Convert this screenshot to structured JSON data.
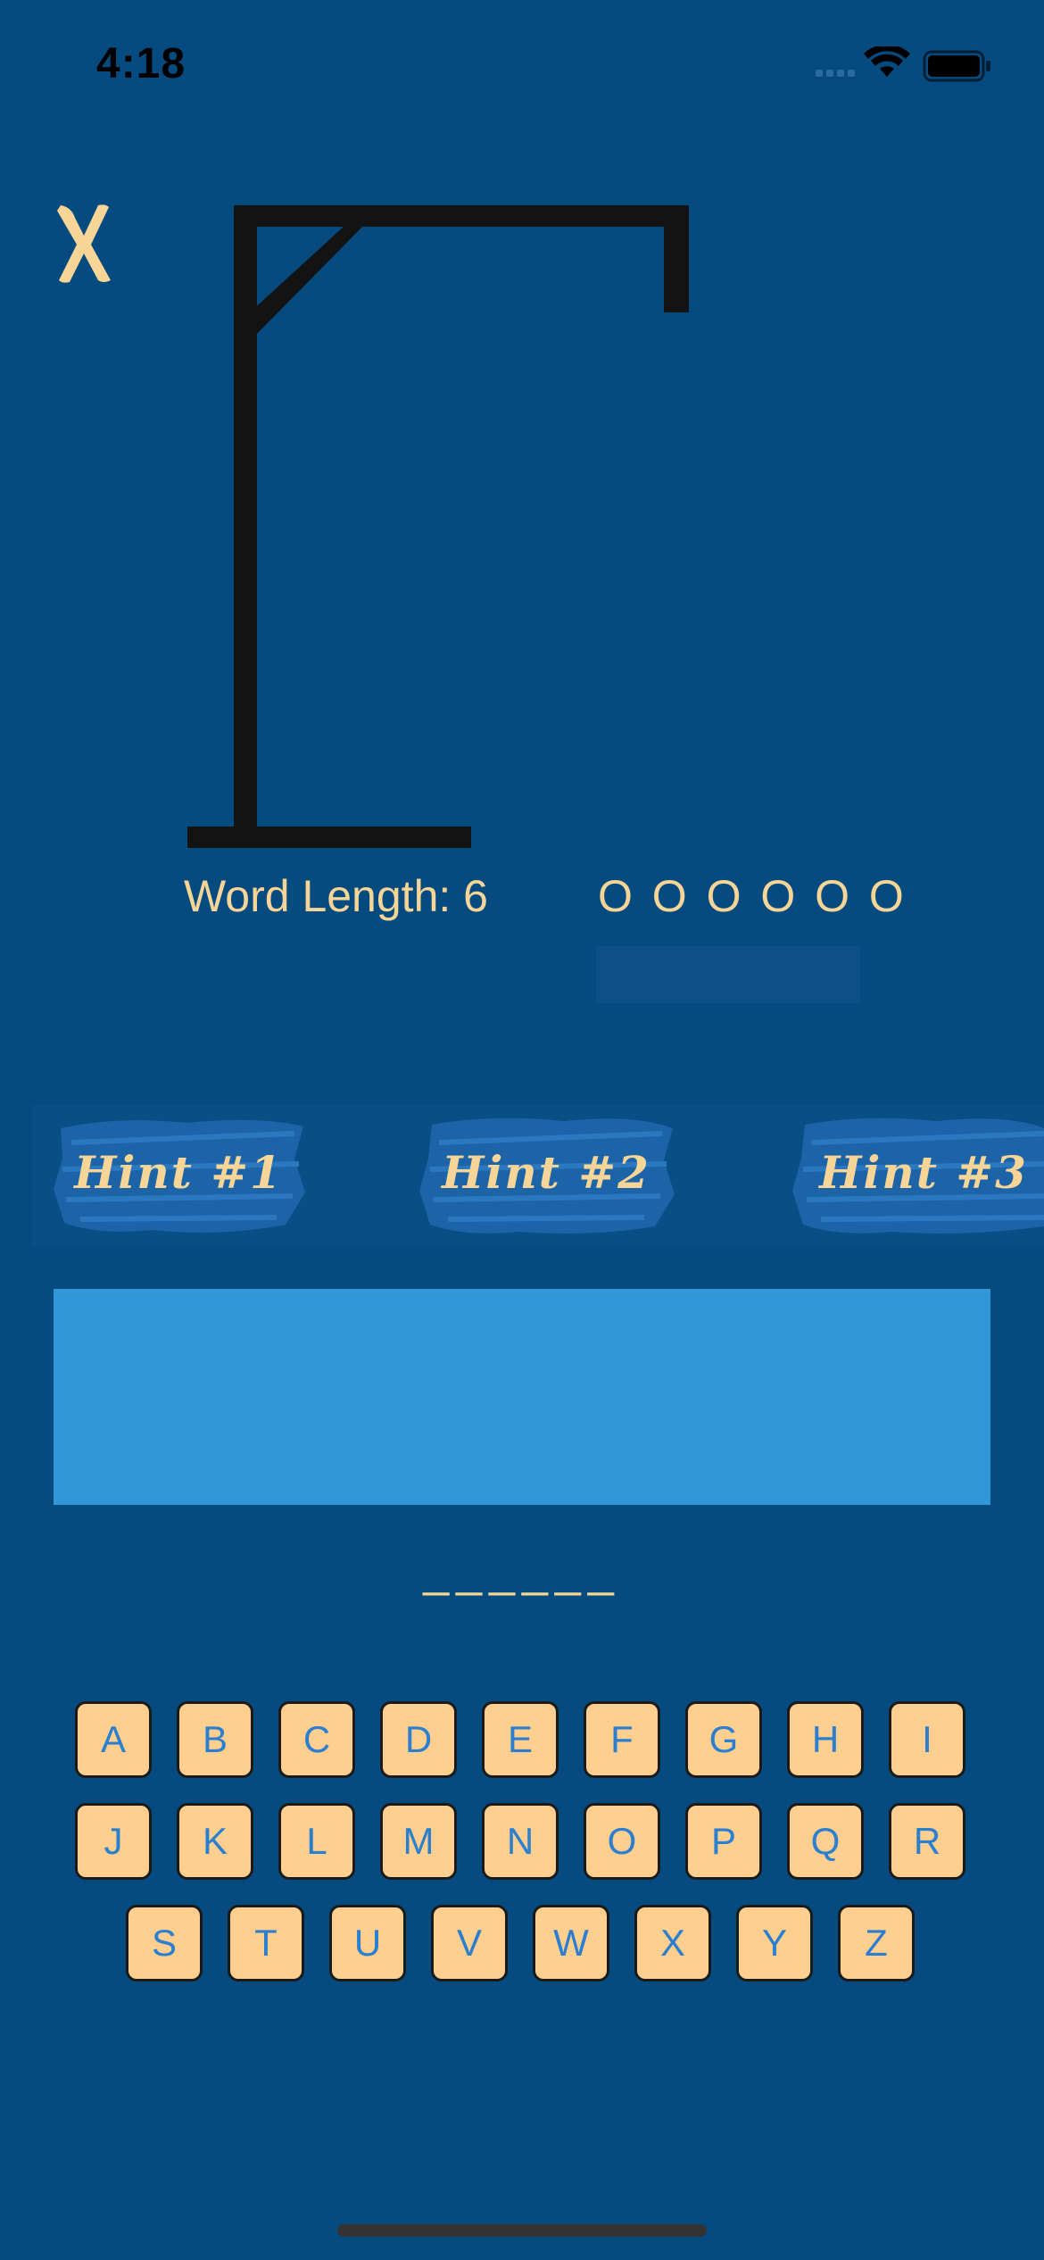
{
  "status_bar": {
    "time": "4:18",
    "icons": [
      "signal-icon",
      "wifi-icon",
      "battery-icon"
    ]
  },
  "close_button": {
    "label": "X",
    "icon": "close-icon"
  },
  "game": {
    "word_length_label": "Word Length: 6",
    "lives": "O O O O O O",
    "word_blanks": "______"
  },
  "hints": [
    {
      "label": "Hint #1"
    },
    {
      "label": "Hint #2"
    },
    {
      "label": "Hint #3"
    }
  ],
  "keyboard": {
    "rows": [
      [
        "A",
        "B",
        "C",
        "D",
        "E",
        "F",
        "G",
        "H",
        "I"
      ],
      [
        "J",
        "K",
        "L",
        "M",
        "N",
        "O",
        "P",
        "Q",
        "R"
      ],
      [
        "S",
        "T",
        "U",
        "V",
        "W",
        "X",
        "Y",
        "Z"
      ]
    ]
  },
  "colors": {
    "background": "#054b80",
    "accent_text": "#f6d597",
    "key_fill": "#fecf8e",
    "key_text": "#2a7fd0",
    "hint_panel": "#3197d6"
  }
}
